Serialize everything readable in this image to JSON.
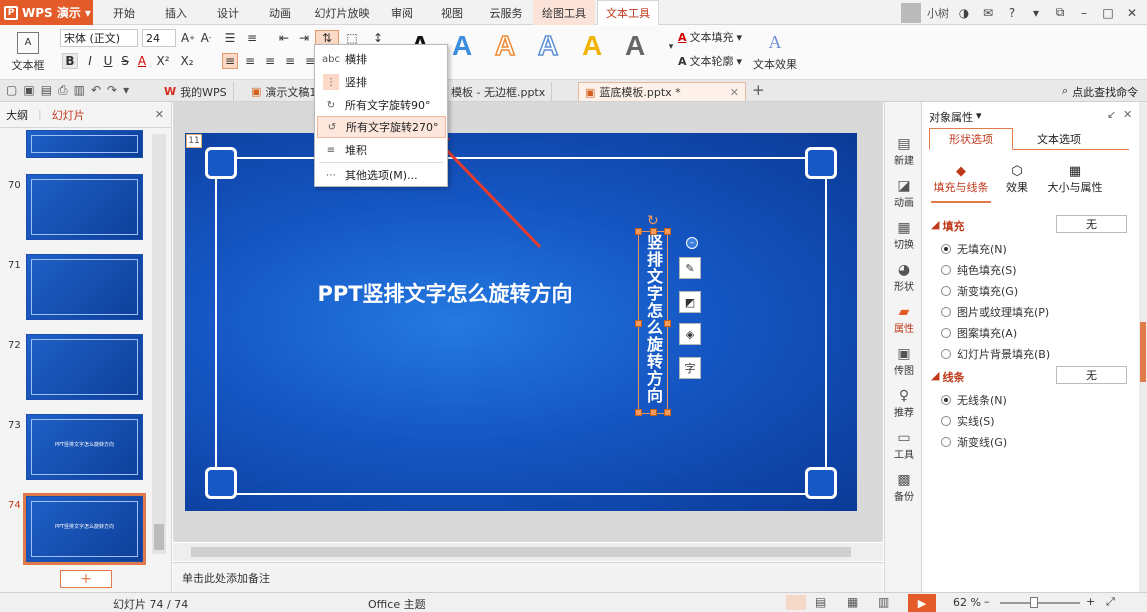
{
  "app": {
    "name": "WPS 演示",
    "logo_letter": "P",
    "user": "小树",
    "accent": "#e25b28"
  },
  "menu": {
    "tabs": [
      "开始",
      "插入",
      "设计",
      "动画",
      "幻灯片放映",
      "审阅",
      "视图",
      "云服务",
      "绘图工具",
      "文本工具"
    ]
  },
  "ribbon": {
    "textbox_label": "文本框",
    "font_name": "宋体 (正文)",
    "font_size": "24",
    "text_fill": "文本填充",
    "text_outline": "文本轮廓",
    "text_effect": "文本效果",
    "bold": "B",
    "italic": "I",
    "underline": "U",
    "strike": "S",
    "font_color": "A",
    "superscript": "X²",
    "subscript": "X₂"
  },
  "dropdown": {
    "items": [
      {
        "icon": "horizontal-text-icon",
        "glyph": "abc",
        "label": "横排"
      },
      {
        "icon": "vertical-text-icon",
        "glyph": "⋮",
        "label": "竖排"
      },
      {
        "icon": "rotate-90-icon",
        "glyph": "↻",
        "label": "所有文字旋转90°"
      },
      {
        "icon": "rotate-270-icon",
        "glyph": "↺",
        "label": "所有文字旋转270°"
      },
      {
        "icon": "stacked-text-icon",
        "glyph": "≡",
        "label": "堆积"
      },
      {
        "icon": "more-options-icon",
        "glyph": "⋯",
        "label": "其他选项(M)..."
      }
    ]
  },
  "doc_tabs": [
    {
      "label": "我的WPS"
    },
    {
      "label": "演示文稿12"
    },
    {
      "label": "模板 - 无边框.pptx"
    },
    {
      "label": "蓝底模板.pptx *"
    }
  ],
  "search": {
    "label": "点此查找命令"
  },
  "left_panel": {
    "tab_outline": "大纲",
    "tab_slides": "幻灯片",
    "slides": [
      {
        "num": "70",
        "title": ""
      },
      {
        "num": "71",
        "title": ""
      },
      {
        "num": "72",
        "title": ""
      },
      {
        "num": "73",
        "title": "PPT竖排文字怎么旋转方向"
      },
      {
        "num": "74",
        "title": "PPT竖排文字怎么旋转方向"
      }
    ],
    "add_slide": "+"
  },
  "slide": {
    "number_badge": "11",
    "title": "PPT竖排文字怎么旋转方向",
    "vertical_text": "竖排文字怎么旋转方向",
    "background": "#1556c3"
  },
  "notes": {
    "placeholder": "单击此处添加备注"
  },
  "right_sidebar": {
    "items": [
      "新建",
      "动画",
      "切换",
      "形状",
      "属性",
      "传图",
      "推荐",
      "工具",
      "备份"
    ]
  },
  "properties": {
    "title": "对象属性",
    "tabs": [
      "形状选项",
      "文本选项"
    ],
    "subtabs": [
      "填充与线条",
      "效果",
      "大小与属性"
    ],
    "fill_section": "填充",
    "fill_value": "无",
    "fill_options": [
      "无填充(N)",
      "纯色填充(S)",
      "渐变填充(G)",
      "图片或纹理填充(P)",
      "图案填充(A)",
      "幻灯片背景填充(B)"
    ],
    "line_section": "线条",
    "line_value": "无",
    "line_options": [
      "无线条(N)",
      "实线(S)",
      "渐变线(G)"
    ]
  },
  "status": {
    "slide_info": "幻灯片 74 / 74",
    "theme": "Office 主题",
    "zoom": "62 %"
  }
}
